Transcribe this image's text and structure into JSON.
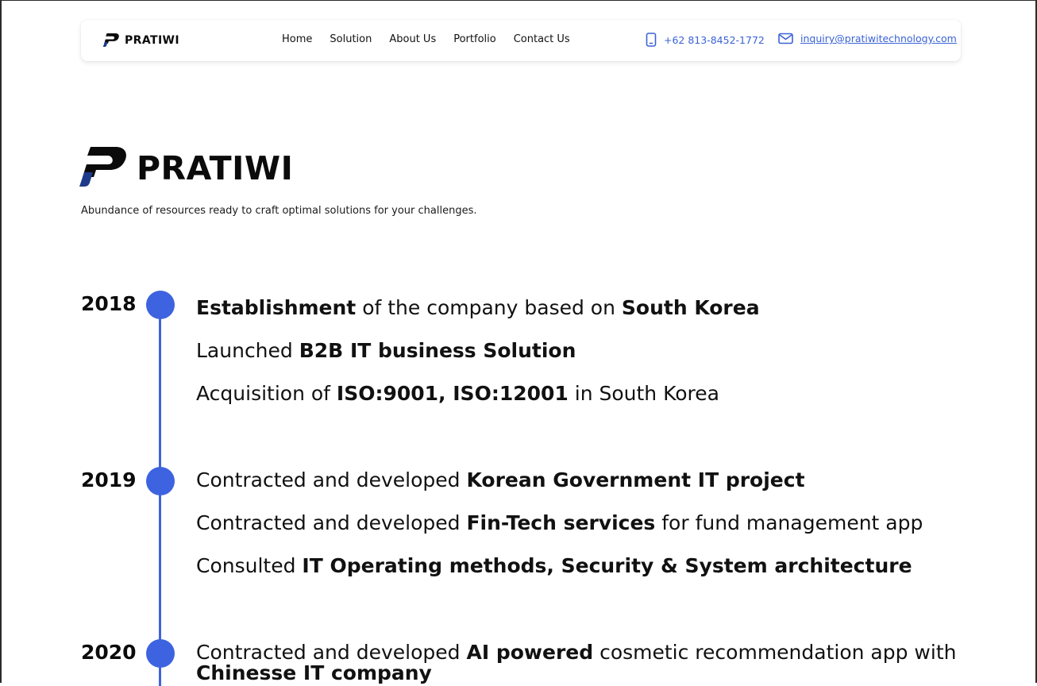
{
  "nav": {
    "logo_text": "PRATIWI",
    "links": [
      "Home",
      "Solution",
      "About Us",
      "Portfolio",
      "Contact Us"
    ],
    "phone": "+62 813-8452-1772",
    "email": "inquiry@pratiwitechnology.com",
    "phone_icon": "phone-icon",
    "email_icon": "mail-icon"
  },
  "hero": {
    "logo_text": "PRATIWI",
    "tagline": "Abundance of resources ready to craft optimal solutions for your challenges."
  },
  "colors": {
    "accent": "#3d63e0",
    "link": "#3a62d6"
  },
  "timeline": [
    {
      "year": "2018",
      "items": [
        [
          {
            "t": "Establishment",
            "b": true
          },
          {
            "t": " of the company based on ",
            "b": false
          },
          {
            "t": "South Korea",
            "b": true
          }
        ],
        [
          {
            "t": "Launched ",
            "b": false
          },
          {
            "t": "B2B IT business Solution",
            "b": true
          }
        ],
        [
          {
            "t": "Acquisition of ",
            "b": false
          },
          {
            "t": "ISO:9001, ISO:12001",
            "b": true
          },
          {
            "t": " in South Korea",
            "b": false
          }
        ]
      ]
    },
    {
      "year": "2019",
      "items": [
        [
          {
            "t": "Contracted and developed ",
            "b": false
          },
          {
            "t": "Korean Government IT project",
            "b": true
          }
        ],
        [
          {
            "t": "Contracted and developed ",
            "b": false
          },
          {
            "t": "Fin-Tech services",
            "b": true
          },
          {
            "t": " for fund management app",
            "b": false
          }
        ],
        [
          {
            "t": "Consulted ",
            "b": false
          },
          {
            "t": "IT Operating methods, Security & System architecture",
            "b": true
          }
        ]
      ]
    },
    {
      "year": "2020",
      "items": [
        [
          {
            "t": "Contracted and developed ",
            "b": false
          },
          {
            "t": "AI powered",
            "b": true
          },
          {
            "t": " cosmetic recommendation app with ",
            "b": false
          },
          {
            "t": "Chinesse IT company",
            "b": true
          }
        ]
      ]
    }
  ]
}
